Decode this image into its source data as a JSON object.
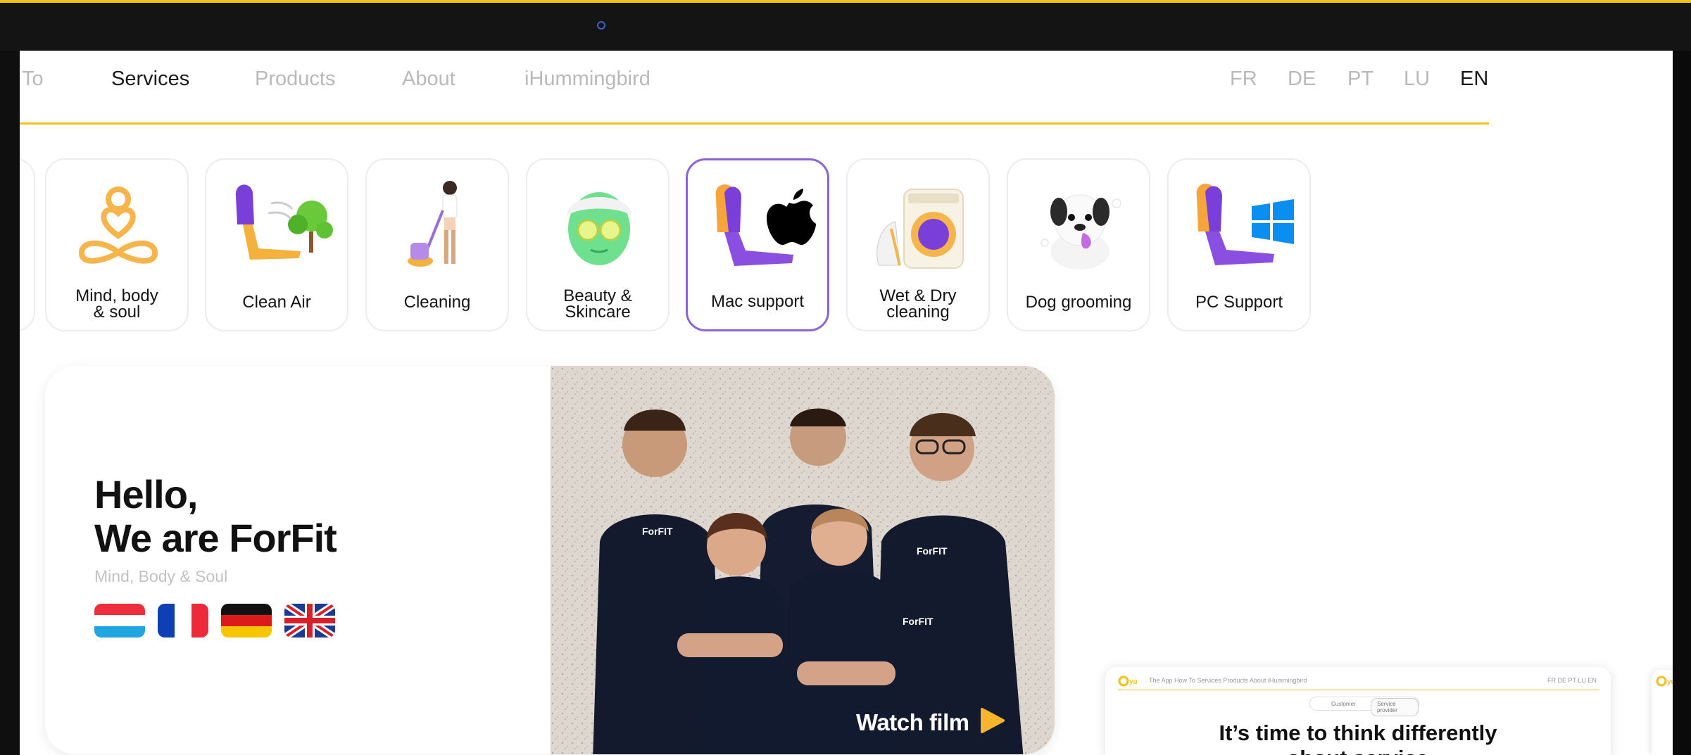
{
  "nav": {
    "items": [
      {
        "label": "To",
        "active": false
      },
      {
        "label": "Services",
        "active": true
      },
      {
        "label": "Products",
        "active": false
      },
      {
        "label": "About",
        "active": false
      },
      {
        "label": "iHummingbird",
        "active": false
      }
    ],
    "languages": [
      {
        "label": "FR",
        "active": false
      },
      {
        "label": "DE",
        "active": false
      },
      {
        "label": "PT",
        "active": false
      },
      {
        "label": "LU",
        "active": false
      },
      {
        "label": "EN",
        "active": true
      }
    ],
    "accent_color": "#f2c21b"
  },
  "services": [
    {
      "label": "Mind, body\n& soul",
      "icon": "meditation-icon"
    },
    {
      "label": "Clean Air",
      "icon": "clean-air-icon"
    },
    {
      "label": "Cleaning",
      "icon": "cleaning-icon"
    },
    {
      "label": "Beauty &\nSkincare",
      "icon": "face-mask-icon"
    },
    {
      "label": "Mac support",
      "icon": "apple-icon",
      "selected": true
    },
    {
      "label": "Wet & Dry\ncleaning",
      "icon": "washing-machine-icon"
    },
    {
      "label": "Dog grooming",
      "icon": "dog-icon"
    },
    {
      "label": "PC Support",
      "icon": "windows-icon"
    }
  ],
  "selected_color": "#8e63d3",
  "hero": {
    "line1": "Hello,",
    "line2": "We are ForFit",
    "subtitle": "Mind, Body & Soul",
    "flags": [
      "luxembourg-flag",
      "france-flag",
      "germany-flag",
      "uk-flag"
    ],
    "watch_label": "Watch film",
    "shirt_text": "ForFIT"
  },
  "preview": {
    "title_line1": "It’s time to think differently",
    "title_line2": "about service",
    "nav": "The App   How To   Services   Products   About   iHummingbird",
    "langs": "FR DE PT LU EN",
    "toggle": [
      "Customer",
      "Service provider"
    ]
  }
}
